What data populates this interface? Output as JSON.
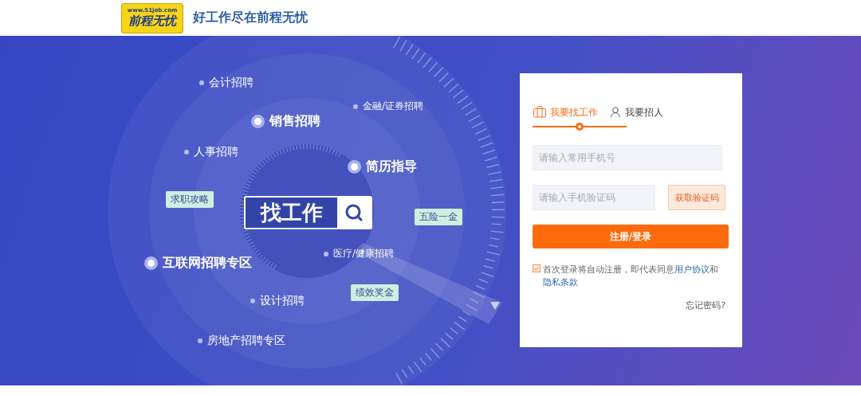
{
  "header": {
    "logo_url": "www.51job.com",
    "logo_text": "前程无忧",
    "slogan": "好工作尽在前程无忧"
  },
  "banner": {
    "labels": [
      {
        "kind": "dot",
        "text": "会计招聘"
      },
      {
        "kind": "dot",
        "text": "金融/证券招聘"
      },
      {
        "kind": "ring",
        "text": "销售招聘"
      },
      {
        "kind": "dot",
        "text": "人事招聘"
      },
      {
        "kind": "ring",
        "text": "简历指导"
      },
      {
        "kind": "tag",
        "text": "求职攻略"
      },
      {
        "kind": "tag",
        "text": "五险一金"
      },
      {
        "kind": "dot",
        "text": "医疗/健康招聘"
      },
      {
        "kind": "ring",
        "text": "互联网招聘专区"
      },
      {
        "kind": "tag",
        "text": "绩效奖金"
      },
      {
        "kind": "dot",
        "text": "设计招聘"
      },
      {
        "kind": "dot",
        "text": "房地产招聘专区"
      }
    ],
    "search": {
      "text": "找工作"
    }
  },
  "login": {
    "tabs": [
      {
        "label": "我要找工作",
        "selected": true
      },
      {
        "label": "我要招人",
        "selected": false
      }
    ],
    "phone": {
      "placeholder": "请输入常用手机号"
    },
    "code": {
      "placeholder": "请输入手机验证码"
    },
    "code_button": "获取验证码",
    "submit": "注册/登录",
    "agreement": {
      "checked": true,
      "text": "首次登录将自动注册，即代表同意",
      "links": [
        "用户协议",
        "隐私条款"
      ],
      "joiner": "和"
    },
    "forgot": "忘记密码?"
  }
}
